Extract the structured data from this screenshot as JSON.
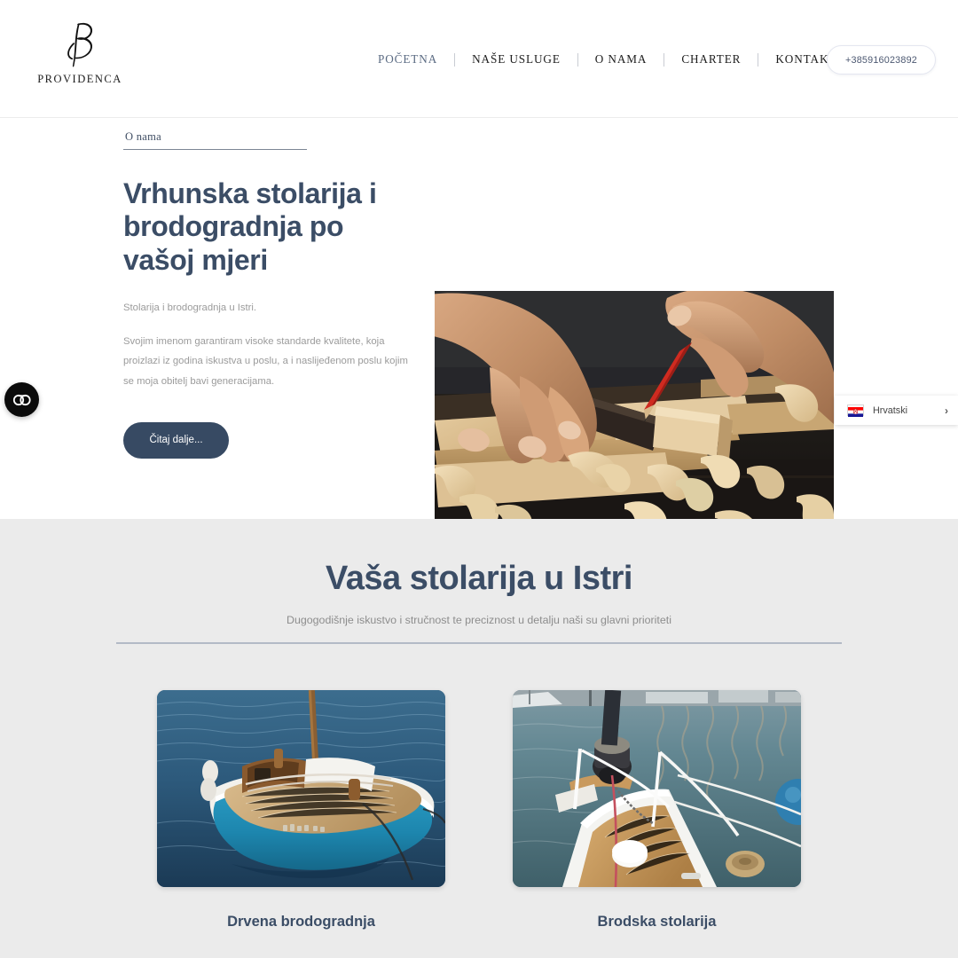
{
  "header": {
    "logo": {
      "monogram_icon": "providenca-monogram-icon",
      "wordmark": "PROVIDENCA"
    },
    "nav": [
      {
        "label": "POČETNA",
        "active": true
      },
      {
        "label": "NAŠE USLUGE",
        "active": false
      },
      {
        "label": "O NAMA",
        "active": false
      },
      {
        "label": "CHARTER",
        "active": false
      },
      {
        "label": "KONTAKT",
        "active": false
      }
    ],
    "phone": "+385916023892"
  },
  "hero": {
    "eyebrow": "O nama",
    "title": "Vrhunska stolarija i brodogradnja po vašoj mjeri",
    "lead": "Stolarija i brodogradnja u Istri.",
    "body": "Svojim imenom garantiram visoke standarde kvalitete, koja proizlazi iz godina iskustva u poslu, a i naslijeđenom poslu kojim se moja obitelj bavi generacijama.",
    "cta_label": "Čitaj dalje...",
    "image_alt": "carpenter-hands-marking-wood-with-pencil-photo"
  },
  "services": {
    "title": "Vaša stolarija u Istri",
    "subtitle": "Dugogodišnje iskustvo i stručnost te preciznost u detalju naši su glavni prioriteti",
    "cards": [
      {
        "title": "Drvena brodogradnja",
        "image_alt": "blue-wooden-boat-on-water-photo"
      },
      {
        "title": "Brodska stolarija",
        "image_alt": "sailboat-teak-deck-in-marina-photo"
      }
    ]
  },
  "widgets": {
    "accessibility": {
      "icon": "accessibility-widget-icon",
      "label": "CO"
    },
    "language": {
      "flag_icon": "croatia-flag-icon",
      "label": "Hrvatski",
      "chevron_icon": "chevron-right-icon",
      "chevron_glyph": "›"
    }
  },
  "colors": {
    "brand_navy": "#3b4d66",
    "cta_navy": "#374a63",
    "nav_active": "#5b6b83",
    "muted_text": "#9b9b9b",
    "section_bg": "#ebebeb",
    "divider": "#b3bac6"
  }
}
